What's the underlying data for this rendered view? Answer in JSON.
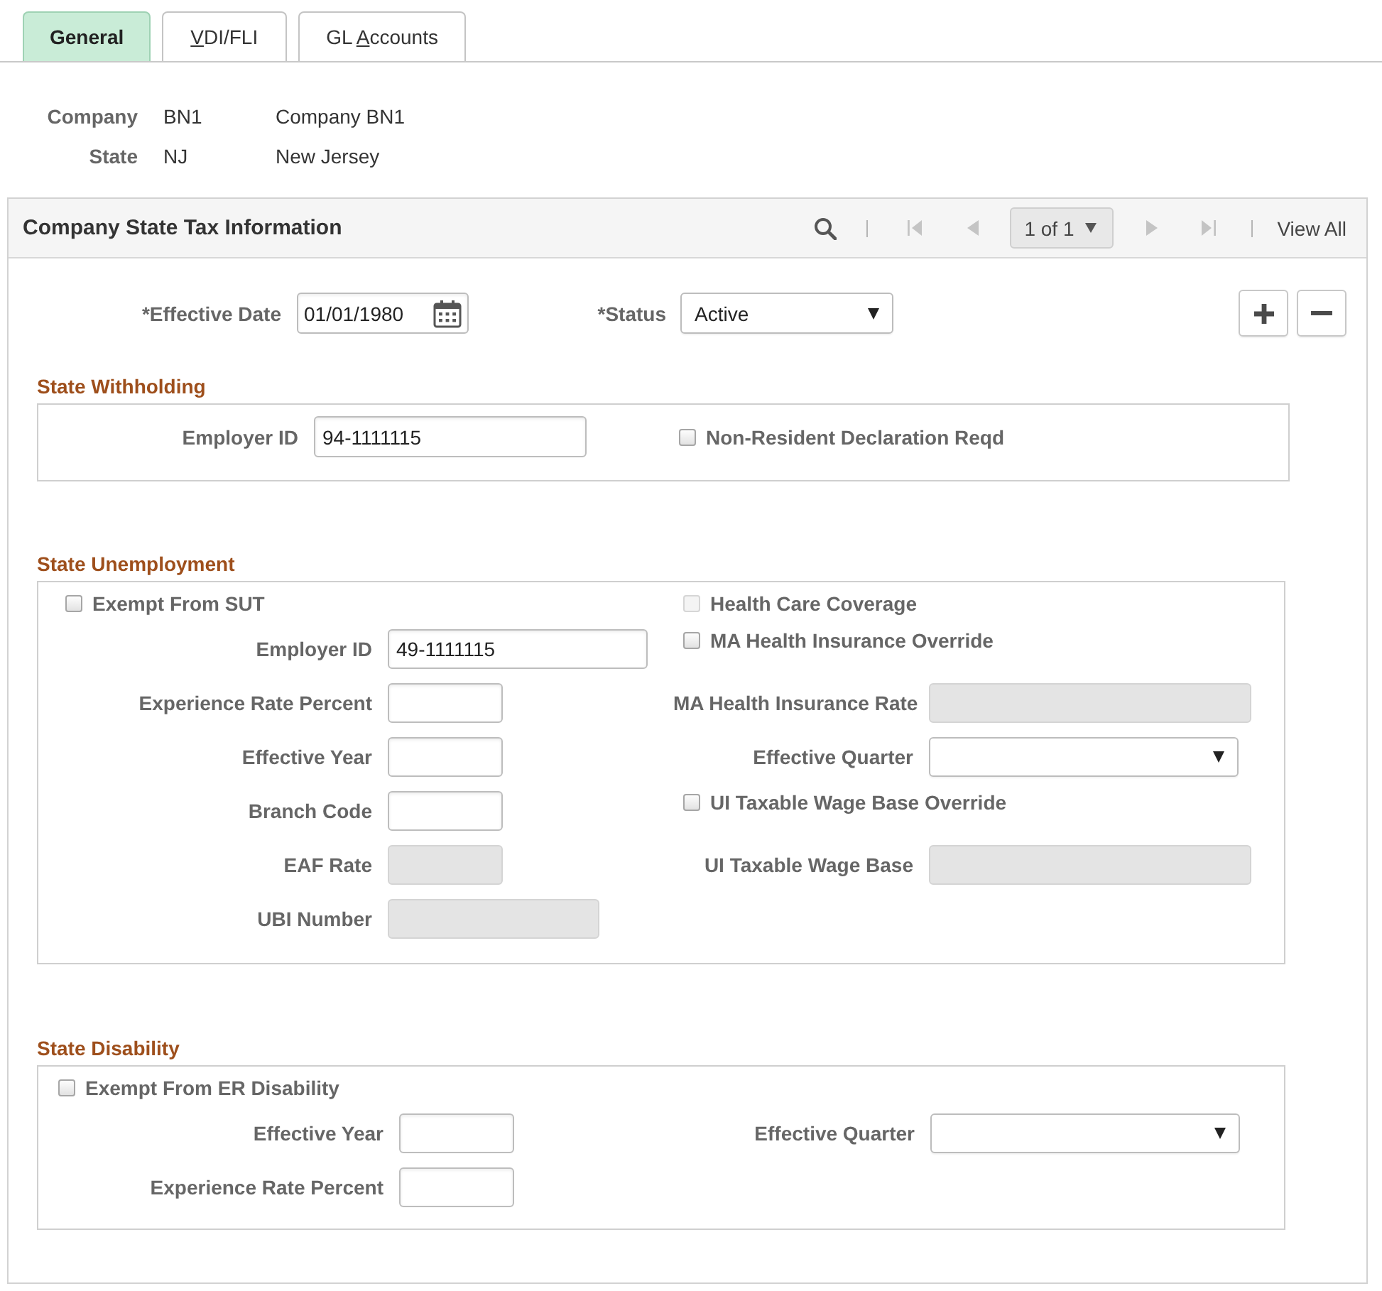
{
  "tabs": [
    {
      "label_start": "General",
      "selected": true
    },
    {
      "access_key": "V",
      "label_end": "DI/FLI",
      "selected": false
    },
    {
      "label_start": "GL ",
      "access_key": "A",
      "label_end": "ccounts",
      "selected": false
    }
  ],
  "keys": [
    {
      "label": "Company",
      "code": "BN1",
      "description": "Company BN1"
    },
    {
      "label": "State",
      "code": "NJ",
      "description": "New Jersey"
    }
  ],
  "panel": {
    "title": "Company State Tax Information",
    "pager": [
      {
        "kind": "search",
        "disabled": false
      },
      {
        "kind": "separator"
      },
      {
        "kind": "first",
        "disabled": true
      },
      {
        "kind": "previous",
        "disabled": true
      },
      {
        "kind": "position",
        "label": "1 of 1"
      },
      {
        "kind": "next",
        "disabled": true
      },
      {
        "kind": "last",
        "disabled": true
      },
      {
        "kind": "separator"
      },
      {
        "kind": "view_all",
        "label": "View All"
      }
    ],
    "effective_date": {
      "label": "*Effective Date",
      "value": "01/01/1980"
    },
    "status": {
      "label": "*Status",
      "value": "Active"
    },
    "row_actions": [
      {
        "kind": "add"
      },
      {
        "kind": "delete"
      }
    ],
    "sections": [
      {
        "title": "State Withholding",
        "rows": [
          {
            "left": {
              "kind": "text",
              "label": "Employer ID",
              "value": "94-1111115",
              "disabled": false
            },
            "right": {
              "kind": "checkbox",
              "label": "Non-Resident Declaration Reqd",
              "checked": false,
              "disabled": false
            }
          }
        ]
      },
      {
        "title": "State Unemployment",
        "rows": [
          {
            "left": {
              "kind": "checkbox",
              "label": "Exempt From SUT",
              "checked": false,
              "disabled": false
            },
            "right": {
              "kind": "checkbox",
              "label": "Health Care Coverage",
              "checked": false,
              "disabled": true
            }
          },
          {
            "left": {
              "kind": "text",
              "label": "Employer ID",
              "value": "49-1111115",
              "disabled": false
            },
            "right": {
              "kind": "checkbox",
              "label": "MA Health Insurance Override",
              "checked": false,
              "disabled": false
            }
          },
          {
            "left": {
              "kind": "text",
              "label": "Experience Rate Percent",
              "disabled": false
            },
            "right": {
              "kind": "text",
              "label": "MA Health Insurance Rate",
              "disabled": true
            }
          },
          {
            "left": {
              "kind": "text",
              "label": "Effective Year",
              "disabled": false
            },
            "right": {
              "kind": "select",
              "label": "Effective Quarter",
              "disabled": false
            }
          },
          {
            "left": {
              "kind": "text",
              "label": "Branch Code",
              "disabled": false
            },
            "right": {
              "kind": "checkbox",
              "label": "UI Taxable Wage Base Override",
              "checked": false,
              "disabled": false
            }
          },
          {
            "left": {
              "kind": "text",
              "label": "EAF Rate",
              "disabled": true
            },
            "right": {
              "kind": "text",
              "label": "UI Taxable Wage Base",
              "disabled": true
            }
          },
          {
            "left": {
              "kind": "text",
              "label": "UBI Number",
              "disabled": true
            }
          }
        ]
      },
      {
        "title": "State Disability",
        "rows": [
          {
            "left": {
              "kind": "checkbox",
              "label": "Exempt From ER Disability",
              "checked": false,
              "disabled": false
            }
          },
          {
            "left": {
              "kind": "text",
              "label": "Effective Year",
              "disabled": false
            },
            "right": {
              "kind": "select",
              "label": "Effective Quarter",
              "disabled": false
            }
          },
          {
            "left": {
              "kind": "text",
              "label": "Experience Rate Percent",
              "disabled": false
            }
          }
        ]
      }
    ]
  }
}
